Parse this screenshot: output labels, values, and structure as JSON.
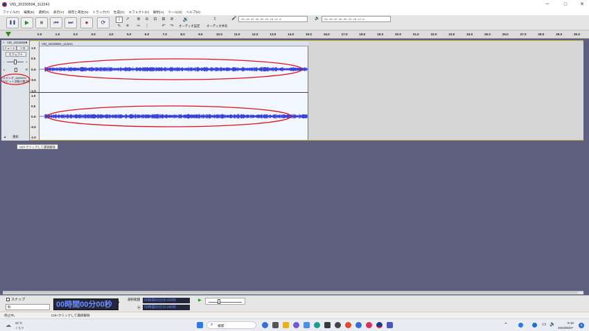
{
  "window": {
    "title": "VID_20230504_112241",
    "minimize_glyph": "─",
    "maximize_glyph": "□",
    "close_glyph": "✕"
  },
  "menu": [
    "ファイル(F)",
    "編集(E)",
    "選択(S)",
    "表示(V)",
    "録音と再生(N)",
    "トラック(T)",
    "生成(G)",
    "エフェクト(C)",
    "解析(A)",
    "ツール(O)",
    "ヘルプ(H)"
  ],
  "toolbar": {
    "pause_glyph": "❚❚",
    "play_glyph": "▶",
    "stop_glyph": "■",
    "skip_start_glyph": "⏮",
    "skip_end_glyph": "⏭",
    "record_glyph": "●",
    "loop_glyph": "⟳",
    "audio_setup_label": "オーディオ設定",
    "share_audio_label": "オーディオ共有",
    "rec_meter_ticks": "-54   -48   -42   -36   -30   -24   -18   -12   -6",
    "play_meter_ticks": "-54   -48   -42   -36   -30   -24   -18   -12   -6"
  },
  "ruler": {
    "ticks": [
      "0.0",
      "1.0",
      "2.0",
      "3.0",
      "4.0",
      "5.0",
      "6.0",
      "7.0",
      "8.0",
      "9.0",
      "10.0",
      "11.0",
      "12.0",
      "13.0",
      "14.0",
      "15.0",
      "16.0",
      "17.0",
      "18.0",
      "19.0",
      "20.0",
      "21.0",
      "22.0",
      "23.0",
      "24.0",
      "25.0",
      "26.0",
      "27.0",
      "28.0",
      "29.0",
      "30.0"
    ]
  },
  "track": {
    "name": "VID_20230504",
    "close_glyph": "×",
    "menu_glyph": "▼",
    "mute_label": "ミュート",
    "solo_label": "ソロ",
    "effects_label": "エフェクト",
    "gain_left_label": "-",
    "gain_right_label": "+",
    "pan_left_label": "L",
    "pan_right_label": "R",
    "info_line1": "ステレオ, 48000Hz",
    "info_line2": "32ビット浮動小数点数",
    "collapse_glyph": "▲",
    "select_label": "選択",
    "clip_title": "VID_20230504_112241",
    "scale_top": [
      "1.0",
      "0.5",
      "0.0-",
      "-0.5",
      "-1.0"
    ],
    "scale_bottom": [
      "1.0",
      "0.5",
      "0.0-",
      "-0.5",
      "-1.0"
    ]
  },
  "tooltip": "Ctrl+クリックして選択解除",
  "bottom": {
    "snap_label": "スナップ",
    "snap_value": "秒",
    "time_display": "00時間00分00秒",
    "selection_label": "選択範囲",
    "sel_start": "00時間00分00.000秒",
    "sel_end": "00時間00分15.040秒"
  },
  "status": {
    "left": "停止中。",
    "middle": "Ctrl+クリックして選択解除"
  },
  "taskbar": {
    "weather_temp": "21°C",
    "weather_desc": "くもり",
    "search_label": "検索",
    "time": "9:16",
    "date": "2023/05/07",
    "notification_count": "4"
  },
  "colors": {
    "waveform": "#3a43d8",
    "annotation_ellipse": "#e0121c",
    "record": "#cc1a1a"
  }
}
